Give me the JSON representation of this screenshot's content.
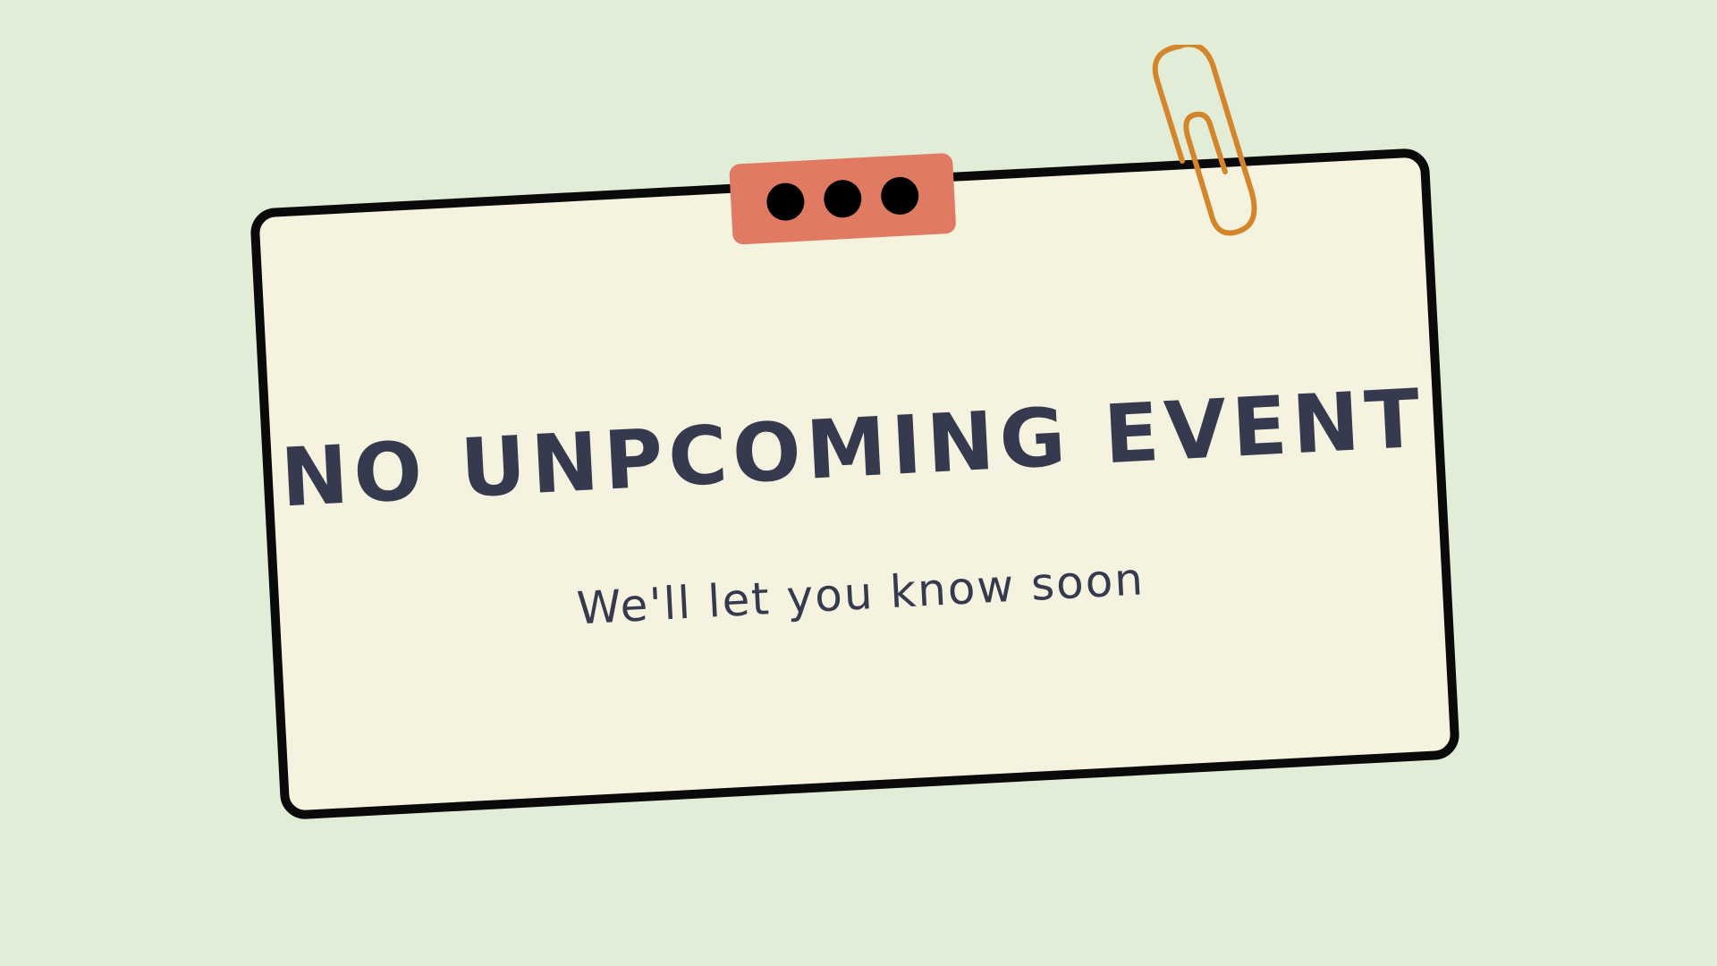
{
  "notice": {
    "title": "NO UNPCOMING EVENT",
    "subtitle": "We'll let you know soon"
  },
  "icons": {
    "tab": "tab-dots-icon",
    "clip": "paperclip-icon"
  },
  "colors": {
    "background": "#e1edd7",
    "card": "#f5f3e0",
    "border": "#0a0a0a",
    "tab": "#e07a63",
    "text": "#363a4e",
    "paperclip": "#d4852a"
  }
}
